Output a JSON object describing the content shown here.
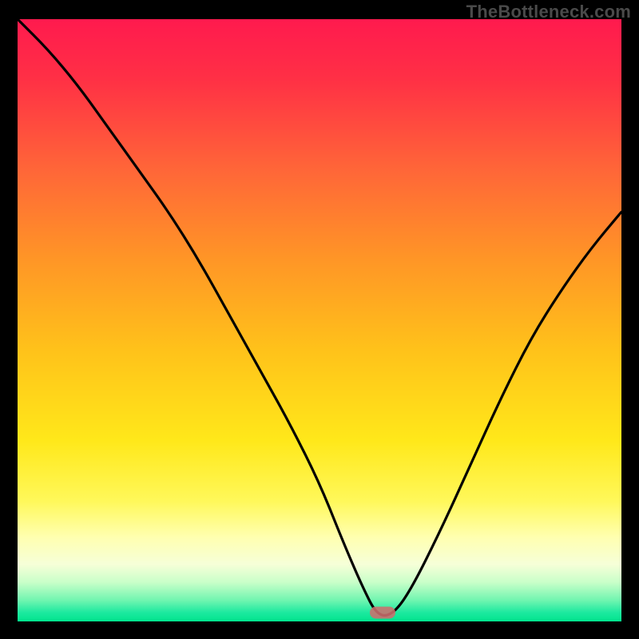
{
  "watermark": "TheBottleneck.com",
  "gradient_stops": [
    {
      "offset": 0.0,
      "color": "#ff1a4e"
    },
    {
      "offset": 0.1,
      "color": "#ff3045"
    },
    {
      "offset": 0.25,
      "color": "#ff6638"
    },
    {
      "offset": 0.4,
      "color": "#ff9626"
    },
    {
      "offset": 0.55,
      "color": "#ffc21a"
    },
    {
      "offset": 0.7,
      "color": "#ffe81a"
    },
    {
      "offset": 0.8,
      "color": "#fff85a"
    },
    {
      "offset": 0.86,
      "color": "#ffffb0"
    },
    {
      "offset": 0.905,
      "color": "#f6ffd8"
    },
    {
      "offset": 0.935,
      "color": "#c9ffc9"
    },
    {
      "offset": 0.965,
      "color": "#70f5b0"
    },
    {
      "offset": 0.985,
      "color": "#1de9a0"
    },
    {
      "offset": 1.0,
      "color": "#00e48d"
    }
  ],
  "marker": {
    "x_frac": 0.605,
    "y_frac": 0.985,
    "color": "#ce6d6d"
  },
  "chart_data": {
    "type": "line",
    "title": "",
    "xlabel": "",
    "ylabel": "",
    "xlim": [
      0,
      1
    ],
    "ylim": [
      0,
      100
    ],
    "series": [
      {
        "name": "bottleneck-curve",
        "x": [
          0.0,
          0.05,
          0.1,
          0.15,
          0.2,
          0.25,
          0.3,
          0.35,
          0.4,
          0.45,
          0.5,
          0.54,
          0.57,
          0.595,
          0.62,
          0.65,
          0.7,
          0.75,
          0.8,
          0.85,
          0.9,
          0.95,
          1.0
        ],
        "y": [
          100,
          95,
          89,
          82,
          75,
          68,
          60,
          51,
          42,
          33,
          23,
          13,
          6,
          1,
          1,
          5,
          15,
          26,
          37,
          47,
          55,
          62,
          68
        ]
      }
    ],
    "annotations": [
      {
        "type": "marker",
        "x": 0.605,
        "y": 1,
        "label": "optimal-point"
      }
    ]
  }
}
